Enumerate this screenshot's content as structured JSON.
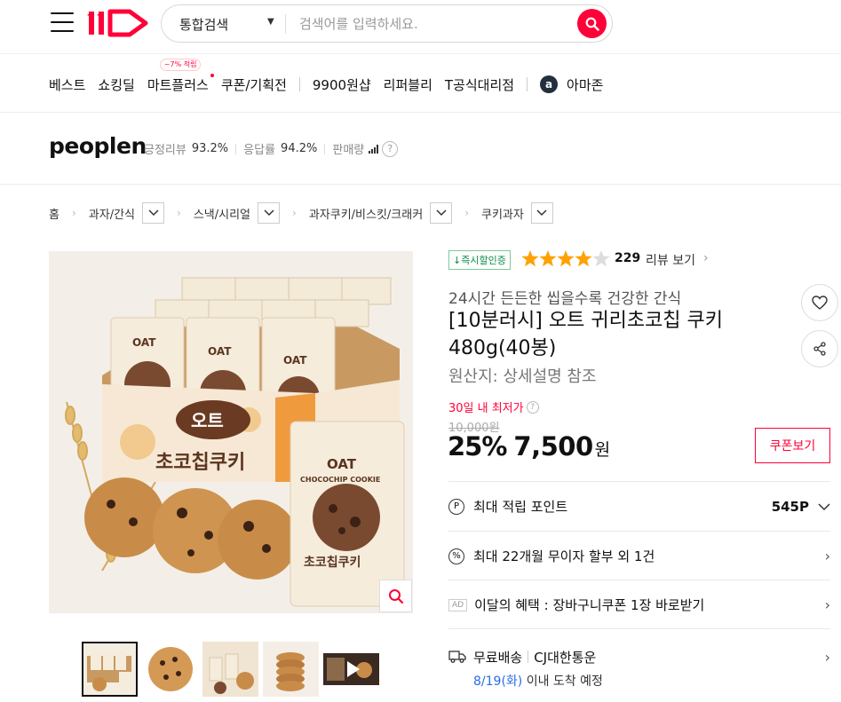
{
  "header": {
    "search_category": "통합검색",
    "search_placeholder": "검색어를 입력하세요."
  },
  "nav": {
    "items": [
      "베스트",
      "쇼킹딜",
      "마트플러스",
      "쿠폰/기획전",
      "9900원샵",
      "리퍼블리",
      "T공식대리점",
      "아마존"
    ],
    "mart_badge": "~7% 적립"
  },
  "seller": {
    "name": "peoplen",
    "positive_review_label": "긍정리뷰",
    "positive_review_value": "93.2%",
    "response_label": "응답률",
    "response_value": "94.2%",
    "sales_label": "판매량"
  },
  "breadcrumb": [
    "홈",
    "과자/간식",
    "스낵/시리얼",
    "과자쿠키/비스킷/크래커",
    "쿠키과자"
  ],
  "product": {
    "instant_discount_badge": "↓즉시할인증",
    "rating": 4.5,
    "review_count": "229",
    "review_link": "리뷰 보기",
    "subtitle": "24시간 든든한 씹을수록 건강한 간식",
    "title": "[10분러시] 오트 귀리초코칩 쿠키 480g(40봉)",
    "origin": "원산지: 상세설명 참조",
    "lowest_label": "30일 내 최저가",
    "original_price": "10,000원",
    "discount": "25%",
    "sale_price": "7,500",
    "won": "원",
    "coupon_button": "쿠폰보기"
  },
  "image_text": {
    "oat": "OAT",
    "choco": "CHOCOCHIP COOKIE",
    "box_brand": "오트",
    "box_name": "초코칩쿠키"
  },
  "benefits": {
    "points_label": "최대 적립 포인트",
    "points_value": "545P",
    "installment": "최대 22개월 무이자 할부 외 1건",
    "ad_tag": "AD",
    "monthly_benefit": "이달의 혜택 : 장바구니쿠폰 1장 바로받기",
    "shipping": "무료배송",
    "carrier": "CJ대한통운",
    "arrival_date": "8/19(화)",
    "arrival_suffix": " 이내 도착 예정"
  },
  "colors": {
    "brand": "#ff0038",
    "link_blue": "#2b6de6",
    "star": "#ffa100"
  }
}
